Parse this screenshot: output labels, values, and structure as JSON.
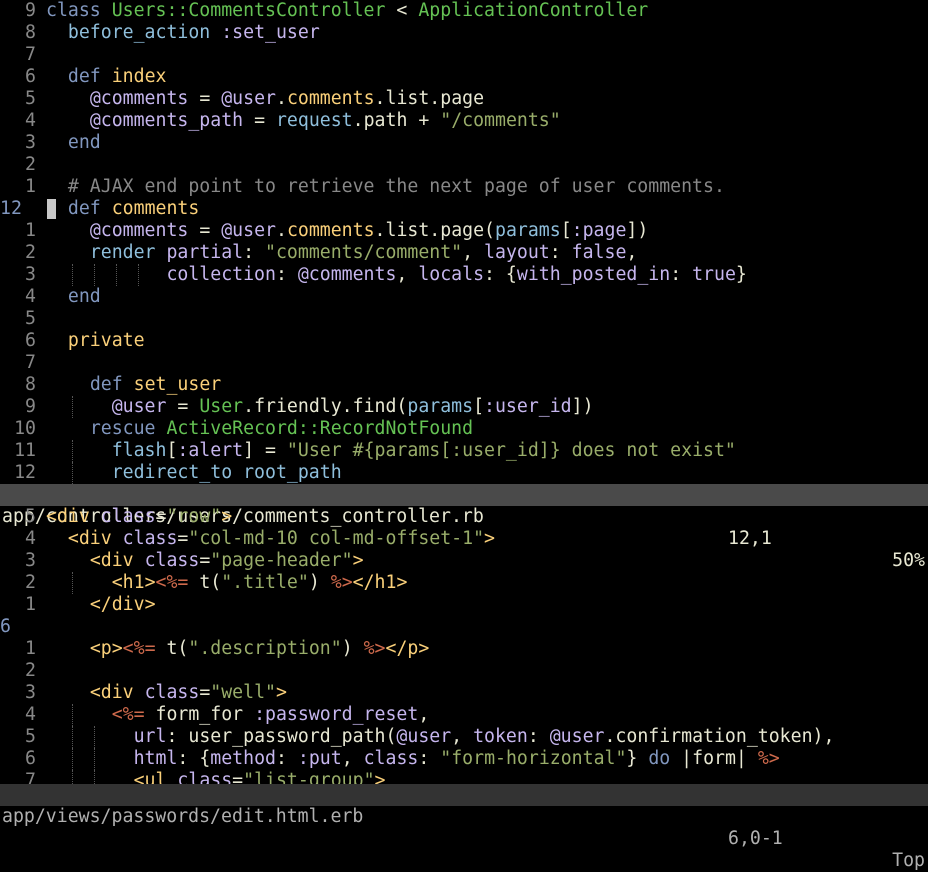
{
  "colors": {
    "background": "#000000",
    "gutter": "#888888",
    "current_line_number": "#8197bf",
    "statusline_bg": "#4a4a4a",
    "keyword": "#8197bf",
    "method_name": "#fad07a",
    "constant": "#65c254",
    "symbol": "#c6b6ee",
    "string": "#99ad6a",
    "erb_delimiter": "#cf6a4c"
  },
  "top_pane": {
    "status": {
      "file": "app/controllers/users/comments_controller.rb",
      "position": "12,1",
      "percent": "50%"
    },
    "lines": [
      {
        "num": "9",
        "text": "class Users::CommentsController < ApplicationController"
      },
      {
        "num": "8",
        "text": "  before_action :set_user"
      },
      {
        "num": "7",
        "text": ""
      },
      {
        "num": "6",
        "text": "  def index"
      },
      {
        "num": "5",
        "text": "    @comments = @user.comments.list.page"
      },
      {
        "num": "4",
        "text": "    @comments_path = request.path + \"/comments\""
      },
      {
        "num": "3",
        "text": "  end"
      },
      {
        "num": "2",
        "text": ""
      },
      {
        "num": "1",
        "text": "  # AJAX end point to retrieve the next page of user comments."
      },
      {
        "num": "12",
        "text": "  def comments",
        "current": true
      },
      {
        "num": "1",
        "text": "    @comments = @user.comments.list.page(params[:page])"
      },
      {
        "num": "2",
        "text": "    render partial: \"comments/comment\", layout: false,"
      },
      {
        "num": "3",
        "text": "           collection: @comments, locals: {with_posted_in: true}"
      },
      {
        "num": "4",
        "text": "  end"
      },
      {
        "num": "5",
        "text": ""
      },
      {
        "num": "6",
        "text": "  private"
      },
      {
        "num": "7",
        "text": ""
      },
      {
        "num": "8",
        "text": "    def set_user"
      },
      {
        "num": "9",
        "text": "      @user = User.friendly.find(params[:user_id])"
      },
      {
        "num": "10",
        "text": "    rescue ActiveRecord::RecordNotFound"
      },
      {
        "num": "11",
        "text": "      flash[:alert] = \"User #{params[:user_id]} does not exist\""
      },
      {
        "num": "12",
        "text": "      redirect_to root_path"
      }
    ]
  },
  "bottom_pane": {
    "status": {
      "file": "app/views/passwords/edit.html.erb",
      "position": "6,0-1",
      "percent": "Top"
    },
    "lines": [
      {
        "num": "5",
        "text": "<div class=\"row\">"
      },
      {
        "num": "4",
        "text": "  <div class=\"col-md-10 col-md-offset-1\">"
      },
      {
        "num": "3",
        "text": "    <div class=\"page-header\">"
      },
      {
        "num": "2",
        "text": "      <h1><%= t(\".title\") %></h1>"
      },
      {
        "num": "1",
        "text": "    </div>"
      },
      {
        "num": "6",
        "text": "",
        "current": true
      },
      {
        "num": "1",
        "text": "    <p><%= t(\".description\") %></p>"
      },
      {
        "num": "2",
        "text": ""
      },
      {
        "num": "3",
        "text": "    <div class=\"well\">"
      },
      {
        "num": "4",
        "text": "      <%= form_for :password_reset,"
      },
      {
        "num": "5",
        "text": "        url: user_password_path(@user, token: @user.confirmation_token),"
      },
      {
        "num": "6",
        "text": "        html: {method: :put, class: \"form-horizontal\"} do |form| %>"
      },
      {
        "num": "7",
        "text": "        <ul class=\"list-group\">"
      }
    ]
  }
}
